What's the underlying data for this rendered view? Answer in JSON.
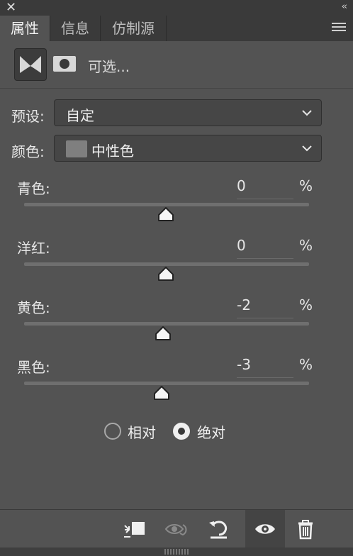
{
  "window": {
    "close_glyph": "✕",
    "collapse_glyph": "‹‹"
  },
  "tabs": [
    {
      "label": "属性",
      "active": true
    },
    {
      "label": "信息",
      "active": false
    },
    {
      "label": "仿制源",
      "active": false
    }
  ],
  "mode": {
    "label": "可选..."
  },
  "preset": {
    "label": "预设:",
    "value": "自定"
  },
  "colors": {
    "label": "颜色:",
    "value": "中性色",
    "swatch": "#7f7f7f"
  },
  "sliders": [
    {
      "name": "青色:",
      "value": "0",
      "unit": "%"
    },
    {
      "name": "洋红:",
      "value": "0",
      "unit": "%"
    },
    {
      "name": "黄色:",
      "value": "-2",
      "unit": "%"
    },
    {
      "name": "黑色:",
      "value": "-3",
      "unit": "%"
    }
  ],
  "method": {
    "options": [
      {
        "label": "相对",
        "selected": false
      },
      {
        "label": "绝对",
        "selected": true
      }
    ]
  },
  "bottom_icons": [
    "clip-to-layer-icon",
    "view-previous-state-icon",
    "reset-icon",
    "visibility-icon",
    "trash-icon"
  ]
}
